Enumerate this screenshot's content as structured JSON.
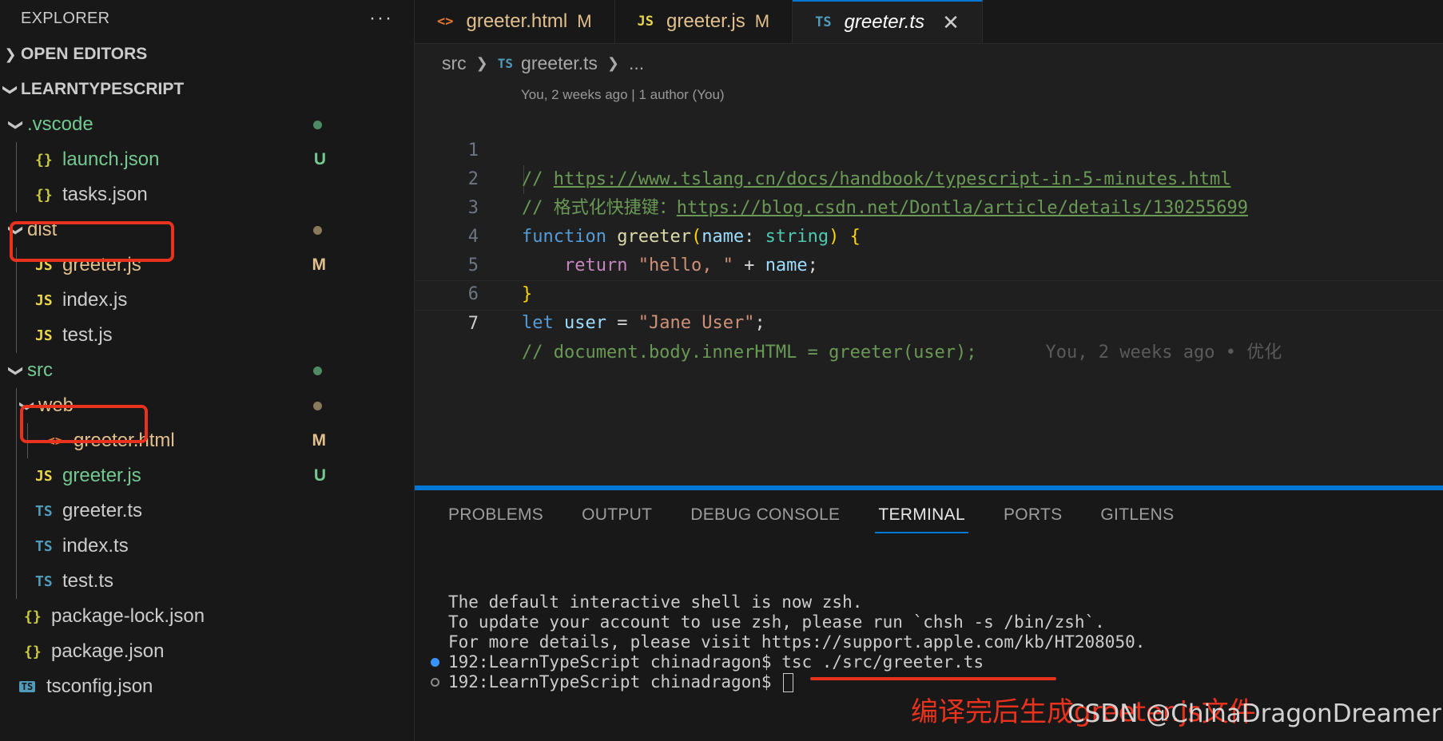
{
  "sidebar": {
    "title": "EXPLORER",
    "more": "···",
    "open_editors": "OPEN EDITORS",
    "project": "LEARNTYPESCRIPT",
    "items": [
      {
        "label": ".vscode",
        "kind": "folder",
        "color": "#73c991",
        "status": "dot",
        "status_color": "#4e8a63"
      },
      {
        "label": "launch.json",
        "kind": "json",
        "icon": "{}",
        "color": "#73c991",
        "status": "U",
        "status_color": "#73c991"
      },
      {
        "label": "tasks.json",
        "kind": "json",
        "icon": "{}",
        "color": "#cccccc"
      },
      {
        "label": "dist",
        "kind": "folder",
        "color": "#e2c08d",
        "status": "dot",
        "status_color": "#8a7a5c"
      },
      {
        "label": "greeter.js",
        "kind": "js",
        "icon": "JS",
        "color": "#e2c08d",
        "status": "M",
        "status_color": "#e2c08d"
      },
      {
        "label": "index.js",
        "kind": "js",
        "icon": "JS",
        "color": "#cccccc"
      },
      {
        "label": "test.js",
        "kind": "js",
        "icon": "JS",
        "color": "#cccccc"
      },
      {
        "label": "src",
        "kind": "folder",
        "color": "#73c991",
        "status": "dot",
        "status_color": "#4e8a63"
      },
      {
        "label": "web",
        "kind": "folder",
        "color": "#e2c08d",
        "status": "dot",
        "status_color": "#8a7a5c"
      },
      {
        "label": "greeter.html",
        "kind": "html",
        "icon": "<>",
        "color": "#e2c08d",
        "status": "M",
        "status_color": "#e2c08d"
      },
      {
        "label": "greeter.js",
        "kind": "js",
        "icon": "JS",
        "color": "#73c991",
        "status": "U",
        "status_color": "#73c991"
      },
      {
        "label": "greeter.ts",
        "kind": "ts",
        "icon": "TS",
        "color": "#cccccc"
      },
      {
        "label": "index.ts",
        "kind": "ts",
        "icon": "TS",
        "color": "#cccccc"
      },
      {
        "label": "test.ts",
        "kind": "ts",
        "icon": "TS",
        "color": "#cccccc"
      },
      {
        "label": "package-lock.json",
        "kind": "json",
        "icon": "{}",
        "color": "#cccccc"
      },
      {
        "label": "package.json",
        "kind": "json",
        "icon": "{}",
        "color": "#cccccc"
      },
      {
        "label": "tsconfig.json",
        "kind": "tsconfig",
        "icon": "TS",
        "color": "#cccccc"
      }
    ]
  },
  "tabs": [
    {
      "label": "greeter.html",
      "icon": "<>",
      "status": "M"
    },
    {
      "label": "greeter.js",
      "icon": "JS",
      "status": "M"
    },
    {
      "label": "greeter.ts",
      "icon": "TS",
      "close": "✕"
    }
  ],
  "breadcrumb": {
    "folder": "src",
    "icon": "TS",
    "file": "greeter.ts",
    "more": "..."
  },
  "codelens": "You, 2 weeks ago | 1 author (You)",
  "code": {
    "line1": {
      "prefix": "// ",
      "link": "https://www.tslang.cn/docs/handbook/typescript-in-5-minutes.html"
    },
    "line2": {
      "prefix": "// 格式化快捷键：",
      "link": "https://blog.csdn.net/Dontla/article/details/130255699"
    },
    "line3": {
      "kw": "function",
      "fn": "greeter",
      "open": "(",
      "param": "name",
      "colon": ": ",
      "type": "string",
      "close": ")",
      "brace": " {"
    },
    "line4": {
      "indent": "    ",
      "kw": "return",
      "str": "\"hello, \"",
      "op": " + ",
      "var": "name",
      "semi": ";"
    },
    "line5": {
      "brace": "}"
    },
    "line6": {
      "kw": "let",
      "var": "user",
      "op": " = ",
      "str": "\"Jane User\"",
      "semi": ";"
    },
    "line7": {
      "comment": "// document.body.innerHTML = greeter(user);",
      "blame": "You, 2 weeks ago • 优化"
    },
    "numbers": [
      "1",
      "2",
      "3",
      "4",
      "5",
      "6",
      "7"
    ]
  },
  "panel": {
    "tabs": [
      "PROBLEMS",
      "OUTPUT",
      "DEBUG CONSOLE",
      "TERMINAL",
      "PORTS",
      "GITLENS"
    ],
    "active_tab": "TERMINAL",
    "terminal": [
      "The default interactive shell is now zsh.",
      "To update your account to use zsh, please run `chsh -s /bin/zsh`.",
      "For more details, please visit https://support.apple.com/kb/HT208050.",
      "192:LearnTypeScript chinadragon$ tsc ./src/greeter.ts",
      "192:LearnTypeScript chinadragon$ "
    ]
  },
  "annotation": "编译完后生成greeter.js文件",
  "watermark": "CSDN @ChinaDragonDreamer"
}
